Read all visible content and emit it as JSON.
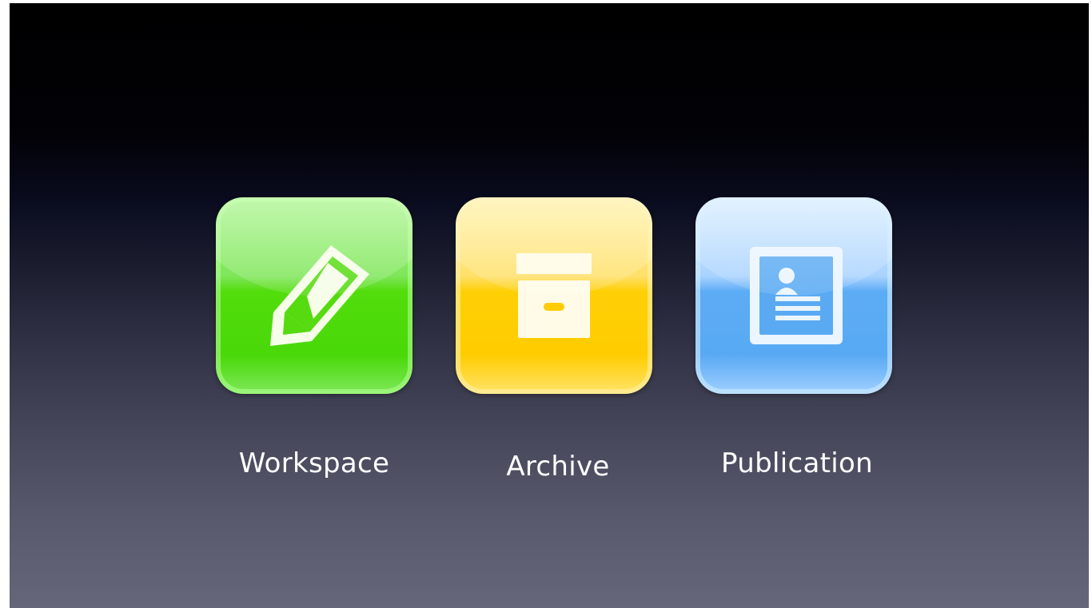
{
  "apps": [
    {
      "id": "workspace",
      "label": "Workspace",
      "icon": "pencil-icon",
      "color": "#4cd90a"
    },
    {
      "id": "archive",
      "label": "Archive",
      "icon": "archive-box-icon",
      "color": "#ffcc00"
    },
    {
      "id": "publication",
      "label": "Publication",
      "icon": "document-profile-icon",
      "color": "#58a9f4"
    }
  ]
}
